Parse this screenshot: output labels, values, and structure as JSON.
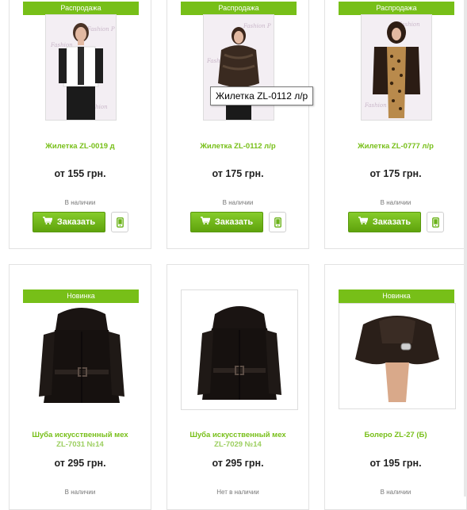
{
  "colors": {
    "accent": "#77bf18",
    "button": "#6bb31a"
  },
  "products": [
    {
      "badge": "Распродажа",
      "name": "Жилетка ZL-0019 д",
      "price": "от 155 грн.",
      "stock": "В наличии",
      "order_label": "Заказать",
      "photo_icon": "vest-photo"
    },
    {
      "badge": "Распродажа",
      "name": "Жилетка ZL-0112 л/р",
      "price": "от 175 грн.",
      "stock": "В наличии",
      "order_label": "Заказать",
      "photo_icon": "vest-photo"
    },
    {
      "badge": "Распродажа",
      "name": "Жилетка ZL-0777 л/р",
      "price": "от 175 грн.",
      "stock": "В наличии",
      "order_label": "Заказать",
      "photo_icon": "vest-photo"
    },
    {
      "badge": "Новинка",
      "name_line1": "Шуба искусственный мех",
      "name_line2": "ZL-7031 №14",
      "price": "от 295 грн.",
      "stock": "В наличии",
      "photo_icon": "fur-coat-photo"
    },
    {
      "badge": "",
      "name_line1": "Шуба искусственный мех",
      "name_line2": "ZL-7029 №14",
      "price": "от 295 грн.",
      "stock": "Нет в наличии",
      "photo_icon": "fur-coat-photo"
    },
    {
      "badge": "Новинка",
      "name": "Болеро ZL-27 (Б)",
      "price": "от 195 грн.",
      "stock": "В наличии",
      "photo_icon": "bolero-photo"
    }
  ],
  "tooltip": "Жилетка ZL-0112 л/р"
}
